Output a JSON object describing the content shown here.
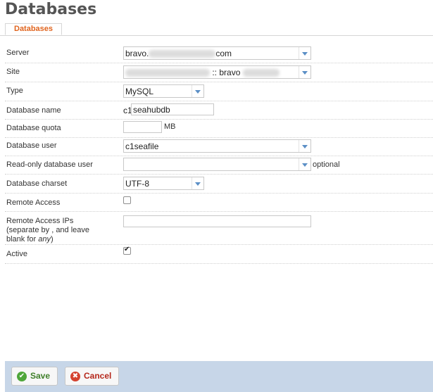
{
  "page": {
    "title": "Databases"
  },
  "tabs": [
    {
      "label": "Databases",
      "active": true
    }
  ],
  "form": {
    "server": {
      "label": "Server",
      "value_prefix": "bravo.",
      "value_suffix": "com"
    },
    "site": {
      "label": "Site",
      "value_middle": ":: bravo"
    },
    "type": {
      "label": "Type",
      "value": "MySQL"
    },
    "database_name": {
      "label": "Database name",
      "prefix": "c1",
      "value": "seahubdb"
    },
    "database_quota": {
      "label": "Database quota",
      "value": "",
      "unit": "MB"
    },
    "database_user": {
      "label": "Database user",
      "value": "c1seafile"
    },
    "readonly_user": {
      "label": "Read-only database user",
      "value": "",
      "note": "optional"
    },
    "charset": {
      "label": "Database charset",
      "value": "UTF-8"
    },
    "remote_access": {
      "label": "Remote Access",
      "checked": false
    },
    "remote_ips": {
      "label_line1": "Remote Access IPs",
      "label_line2": "(separate by , and leave",
      "label_line3_a": "blank for ",
      "label_line3_em": "any",
      "label_line3_b": ")",
      "value": ""
    },
    "active": {
      "label": "Active",
      "checked": true
    }
  },
  "buttons": {
    "save": "Save",
    "cancel": "Cancel"
  },
  "icons": {
    "save": "check-circle-icon",
    "cancel": "cancel-circle-icon",
    "dropdown": "chevron-down-icon"
  },
  "colors": {
    "accent": "#e0641e",
    "footer": "#c7d6e8",
    "save": "#3f7f2a",
    "cancel": "#b5271b"
  }
}
